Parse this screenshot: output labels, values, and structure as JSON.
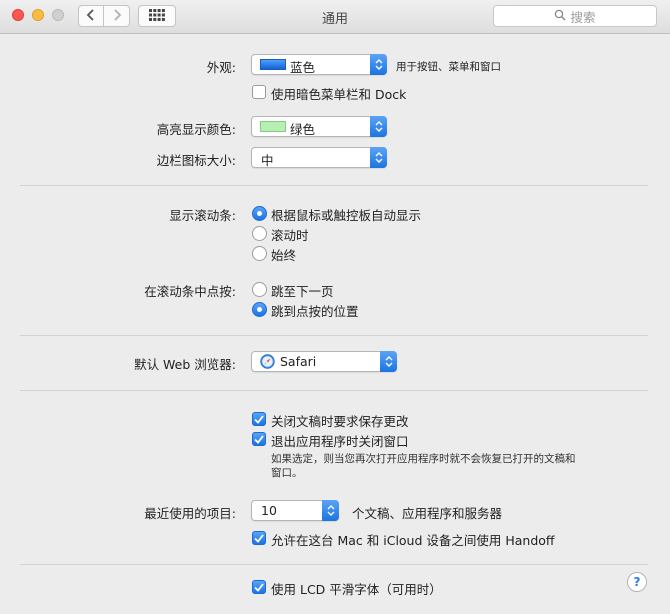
{
  "window": {
    "title": "通用"
  },
  "search": {
    "placeholder": "搜索"
  },
  "appearance": {
    "label": "外观:",
    "value": "蓝色",
    "hint": "用于按钮、菜单和窗口",
    "swatch_color": "#1f6fe0"
  },
  "dark_menu": {
    "label": "使用暗色菜单栏和 Dock",
    "checked": false
  },
  "highlight": {
    "label": "高亮显示颜色:",
    "value": "绿色",
    "swatch_color": "#b6f0b0"
  },
  "sidebar_icon": {
    "label": "边栏图标大小:",
    "value": "中"
  },
  "scrollbars": {
    "label": "显示滚动条:",
    "options": [
      "根据鼠标或触控板自动显示",
      "滚动时",
      "始终"
    ],
    "selected": 0
  },
  "scroll_click": {
    "label": "在滚动条中点按:",
    "options": [
      "跳至下一页",
      "跳到点按的位置"
    ],
    "selected": 1
  },
  "browser": {
    "label": "默认 Web 浏览器:",
    "value": "Safari"
  },
  "documents": {
    "ask_save_label": "关闭文稿时要求保存更改",
    "ask_save_checked": true,
    "close_windows_label": "退出应用程序时关闭窗口",
    "close_windows_checked": true,
    "note": "如果选定，则当您再次打开应用程序时就不会恢复已打开的文稿和窗口。"
  },
  "recent": {
    "label": "最近使用的项目:",
    "value": "10",
    "suffix": "个文稿、应用程序和服务器"
  },
  "handoff": {
    "label": "允许在这台 Mac 和 iCloud 设备之间使用 Handoff",
    "checked": true
  },
  "lcd": {
    "label": "使用 LCD 平滑字体（可用时）",
    "checked": true
  },
  "help": {
    "label": "?"
  },
  "colors": {
    "accent": "#1a74e3"
  }
}
